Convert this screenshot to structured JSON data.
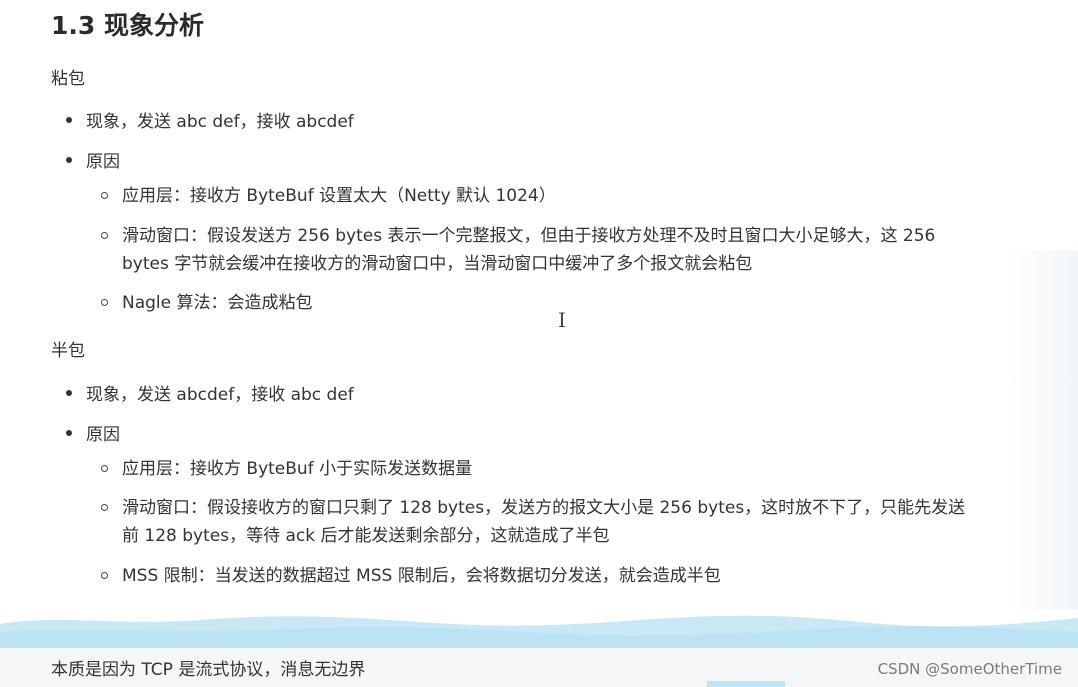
{
  "heading": "1.3 现象分析",
  "sticky": {
    "label": "粘包",
    "bullets": [
      {
        "text": "现象，发送 abc def，接收 abcdef"
      },
      {
        "text": "原因"
      }
    ],
    "reasons": [
      "应用层：接收方 ByteBuf 设置太大（Netty 默认 1024）",
      "滑动窗口：假设发送方 256 bytes 表示一个完整报文，但由于接收方处理不及时且窗口大小足够大，这 256 bytes 字节就会缓冲在接收方的滑动窗口中，当滑动窗口中缓冲了多个报文就会粘包",
      "Nagle 算法：会造成粘包"
    ]
  },
  "half": {
    "label": "半包",
    "bullets": [
      {
        "text": "现象，发送 abcdef，接收 abc def"
      },
      {
        "text": "原因"
      }
    ],
    "reasons": [
      "应用层：接收方 ByteBuf 小于实际发送数据量",
      "滑动窗口：假设接收方的窗口只剩了 128 bytes，发送方的报文大小是 256 bytes，这时放不下了，只能先发送前 128 bytes，等待 ack 后才能发送剩余部分，这就造成了半包",
      "MSS 限制：当发送的数据超过 MSS 限制后，会将数据切分发送，就会造成半包"
    ]
  },
  "footer": "本质是因为 TCP 是流式协议，消息无边界",
  "watermark": "CSDN @SomeOtherTime",
  "cursor_glyph": "I",
  "colors": {
    "wave": "#c8e8f6",
    "wave_line": "#29aee6",
    "text": "#333333"
  }
}
